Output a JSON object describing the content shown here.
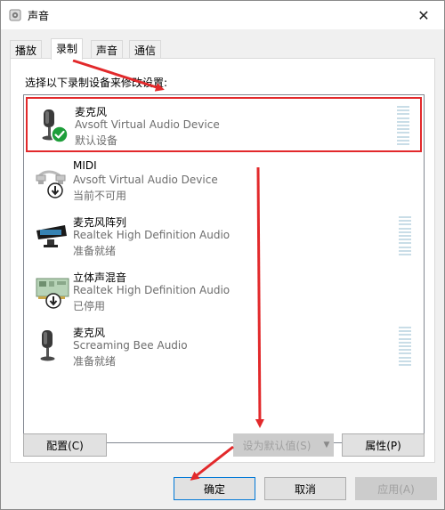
{
  "window": {
    "title": "声音",
    "close_glyph": "✕"
  },
  "tabs": [
    {
      "label": "播放"
    },
    {
      "label": "录制"
    },
    {
      "label": "声音"
    },
    {
      "label": "通信"
    }
  ],
  "panel": {
    "instruction": "选择以下录制设备来修改设置:"
  },
  "devices": [
    {
      "name": "麦克风",
      "driver": "Avsoft Virtual Audio Device",
      "status": "默认设备",
      "icon": "microphone-icon",
      "badge": "default-check-icon",
      "selected": true,
      "meter": true
    },
    {
      "name": "MIDI",
      "driver": "Avsoft Virtual Audio Device",
      "status": "当前不可用",
      "icon": "midi-plug-icon",
      "badge": "down-arrow-badge-icon",
      "selected": false,
      "meter": false
    },
    {
      "name": "麦克风阵列",
      "driver": "Realtek High Definition Audio",
      "status": "准备就绪",
      "icon": "microphone-array-icon",
      "badge": "",
      "selected": false,
      "meter": true
    },
    {
      "name": "立体声混音",
      "driver": "Realtek High Definition Audio",
      "status": "已停用",
      "icon": "sound-card-icon",
      "badge": "down-arrow-badge-icon",
      "selected": false,
      "meter": false
    },
    {
      "name": "麦克风",
      "driver": "Screaming Bee Audio",
      "status": "准备就绪",
      "icon": "microphone-icon",
      "badge": "",
      "selected": false,
      "meter": true
    }
  ],
  "buttons": {
    "configure": "配置(C)",
    "set_default": "设为默认值(S)",
    "properties": "属性(P)",
    "ok": "确定",
    "cancel": "取消",
    "apply": "应用(A)"
  },
  "colors": {
    "selection_border": "#e2292b",
    "annotation_arrow": "#e2292b",
    "check_badge": "#1e9e3a",
    "meter": "#c9dde7"
  }
}
